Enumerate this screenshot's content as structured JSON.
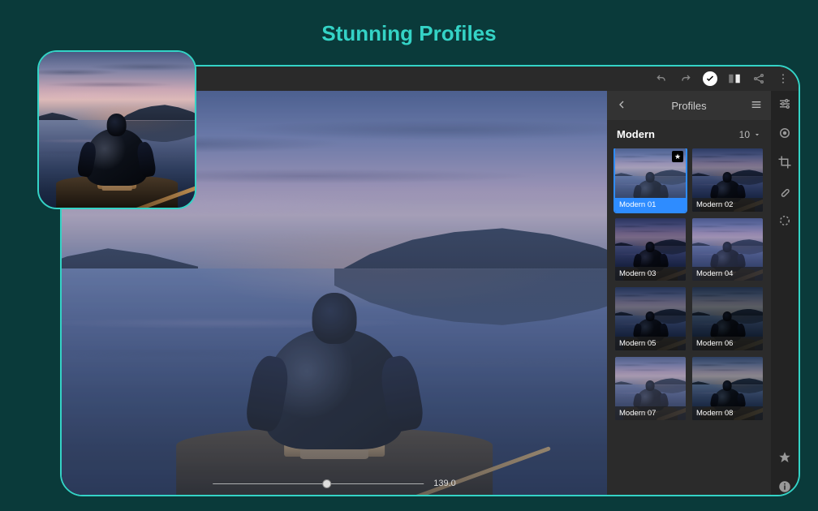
{
  "headline": "Stunning Profiles",
  "topbar": {
    "icons": [
      "undo",
      "redo",
      "confirm",
      "compare",
      "share",
      "more"
    ]
  },
  "panel": {
    "title": "Profiles",
    "back_label": "Back",
    "menu_label": "Panel menu"
  },
  "category": {
    "name": "Modern",
    "count": "10"
  },
  "profiles": [
    {
      "label": "Modern 01",
      "tint": "m01",
      "selected": true,
      "starred": true
    },
    {
      "label": "Modern 02",
      "tint": "m02",
      "selected": false,
      "starred": false
    },
    {
      "label": "Modern 03",
      "tint": "m03",
      "selected": false,
      "starred": false
    },
    {
      "label": "Modern 04",
      "tint": "m04",
      "selected": false,
      "starred": false
    },
    {
      "label": "Modern 05",
      "tint": "m05",
      "selected": false,
      "starred": false
    },
    {
      "label": "Modern 06",
      "tint": "m06",
      "selected": false,
      "starred": false
    },
    {
      "label": "Modern 07",
      "tint": "m07",
      "selected": false,
      "starred": false
    },
    {
      "label": "Modern 08",
      "tint": "m08",
      "selected": false,
      "starred": false
    }
  ],
  "slider": {
    "value": "139.0"
  },
  "rail": {
    "tools": [
      "adjust",
      "target",
      "crop",
      "heal",
      "radial"
    ],
    "footer": [
      "favorite",
      "info"
    ]
  }
}
